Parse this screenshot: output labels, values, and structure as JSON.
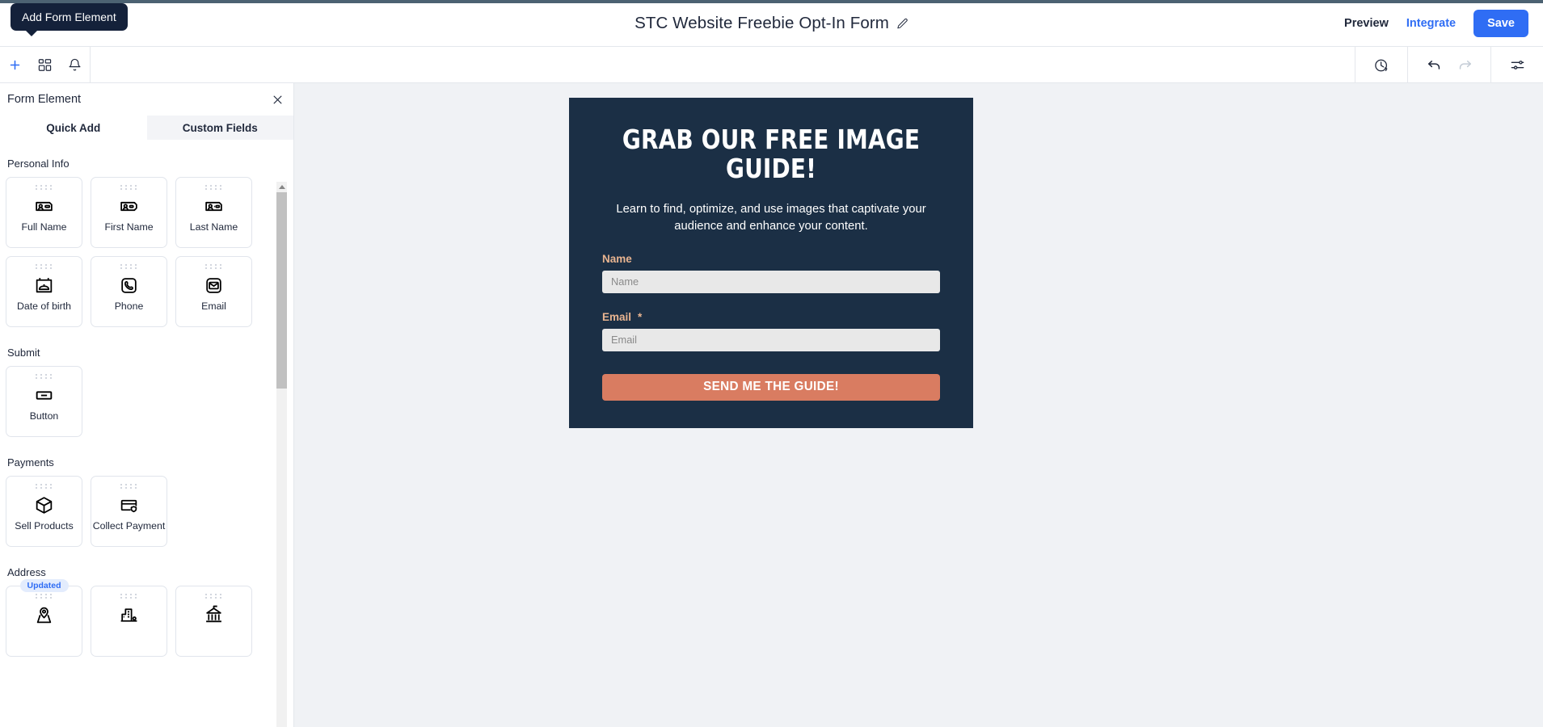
{
  "topbar": {
    "back_icon": "back-arrow-icon",
    "title": "STC Website Freebie Opt-In Form",
    "edit_icon": "pencil-icon",
    "preview_label": "Preview",
    "integrate_label": "Integrate",
    "save_label": "Save",
    "accent_color": "#4c6272",
    "save_color": "#2f6df4"
  },
  "tooltip": {
    "text": "Add Form Element"
  },
  "toolbar": {
    "left_icons": [
      "plus-icon",
      "form-layout-icon",
      "bell-icon"
    ],
    "right_icons": [
      "history-clock-icon",
      "undo-icon",
      "redo-icon",
      "settings-sliders-icon"
    ]
  },
  "panel": {
    "title": "Form Element",
    "close_icon": "close-icon",
    "tabs": [
      {
        "label": "Quick Add",
        "active": true
      },
      {
        "label": "Custom Fields",
        "active": false
      }
    ],
    "sections": [
      {
        "title": "Personal Info",
        "cards": [
          {
            "label": "Full Name",
            "icon": "id-card-person-icon"
          },
          {
            "label": "First Name",
            "icon": "id-card-person-tag-icon"
          },
          {
            "label": "Last Name",
            "icon": "id-card-person-line-icon"
          },
          {
            "label": "Date of birth",
            "icon": "birthday-cake-calendar-icon"
          },
          {
            "label": "Phone",
            "icon": "phone-icon"
          },
          {
            "label": "Email",
            "icon": "envelope-icon"
          }
        ]
      },
      {
        "title": "Submit",
        "cards": [
          {
            "label": "Button",
            "icon": "button-icon"
          }
        ]
      },
      {
        "title": "Payments",
        "cards": [
          {
            "label": "Sell Products",
            "icon": "package-box-icon"
          },
          {
            "label": "Collect Payment",
            "icon": "credit-card-shield-icon"
          }
        ]
      },
      {
        "title": "Address",
        "cards": [
          {
            "label": "",
            "icon": "map-pin-icon",
            "badge": "Updated"
          },
          {
            "label": "",
            "icon": "building-city-icon"
          },
          {
            "label": "",
            "icon": "bank-building-icon"
          }
        ]
      }
    ]
  },
  "form_preview": {
    "background": "#1b2f45",
    "heading": "GRAB OUR FREE IMAGE GUIDE!",
    "subheading": "Learn to find, optimize, and use images that captivate your audience and enhance your content.",
    "fields": [
      {
        "label": "Name",
        "required": "",
        "placeholder": "Name",
        "value": ""
      },
      {
        "label": "Email",
        "required": "*",
        "placeholder": "Email",
        "value": ""
      }
    ],
    "submit_label": "SEND ME THE GUIDE!",
    "submit_color": "#d97c61",
    "label_color": "#e8b490"
  }
}
